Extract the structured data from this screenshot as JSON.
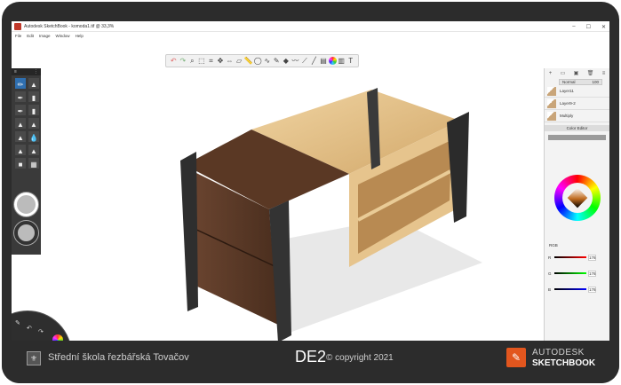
{
  "window": {
    "title": "Autodesk SketchBook - komoda1.tif @ 33,3%"
  },
  "window_controls": [
    "–",
    "☐",
    "✕"
  ],
  "menu": [
    "File",
    "Edit",
    "Image",
    "Window",
    "Help"
  ],
  "layers_panel": {
    "blend_mode": "Normal",
    "opacity": "100",
    "layers": [
      {
        "name": "Layer11"
      },
      {
        "name": "Layer9-2"
      },
      {
        "name": "Multiply"
      }
    ]
  },
  "color_editor": {
    "title": "Color Editor",
    "mode": "RGB",
    "channels": [
      {
        "name": "R",
        "value": "176"
      },
      {
        "name": "G",
        "value": "176"
      },
      {
        "name": "B",
        "value": "176"
      }
    ]
  },
  "footer": {
    "school": "Střední škola řezbářská Tovačov",
    "code": "DE2",
    "copyright": "© copyright 2021",
    "brand_line1": "AUTODESK",
    "brand_line2": "SKETCHBOOK"
  },
  "colors": {
    "frame": "#2c2c2c",
    "accent_orange": "#e2561e",
    "wood_light": "#e3c18d",
    "wood_dark": "#5a3824",
    "steel": "#2e2e2e"
  }
}
